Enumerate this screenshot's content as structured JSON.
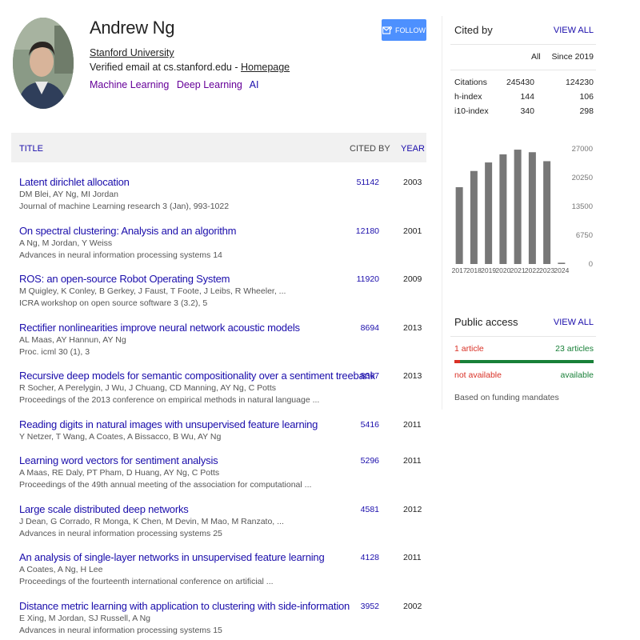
{
  "profile": {
    "name": "Andrew Ng",
    "affiliation": "Stanford University",
    "email_text": "Verified email at cs.stanford.edu - ",
    "homepage_label": "Homepage",
    "interests": [
      "Machine Learning",
      "Deep Learning",
      "AI"
    ],
    "follow_label": "FOLLOW"
  },
  "table": {
    "title_header": "TITLE",
    "cited_header": "CITED BY",
    "year_header": "YEAR",
    "articles": [
      {
        "title": "Latent dirichlet allocation",
        "authors": "DM Blei, AY Ng, MI Jordan",
        "venue": "Journal of machine Learning research 3 (Jan), 993-1022",
        "cited": "51142",
        "year": "2003"
      },
      {
        "title": "On spectral clustering: Analysis and an algorithm",
        "authors": "A Ng, M Jordan, Y Weiss",
        "venue": "Advances in neural information processing systems 14",
        "cited": "12180",
        "year": "2001"
      },
      {
        "title": "ROS: an open-source Robot Operating System",
        "authors": "M Quigley, K Conley, B Gerkey, J Faust, T Foote, J Leibs, R Wheeler, ...",
        "venue": "ICRA workshop on open source software 3 (3.2), 5",
        "cited": "11920",
        "year": "2009"
      },
      {
        "title": "Rectifier nonlinearities improve neural network acoustic models",
        "authors": "AL Maas, AY Hannun, AY Ng",
        "venue": "Proc. icml 30 (1), 3",
        "cited": "8694",
        "year": "2013"
      },
      {
        "title": "Recursive deep models for semantic compositionality over a sentiment treebank",
        "authors": "R Socher, A Perelygin, J Wu, J Chuang, CD Manning, AY Ng, C Potts",
        "venue": "Proceedings of the 2013 conference on empirical methods in natural language ...",
        "cited": "8367",
        "year": "2013"
      },
      {
        "title": "Reading digits in natural images with unsupervised feature learning",
        "authors": "Y Netzer, T Wang, A Coates, A Bissacco, B Wu, AY Ng",
        "venue": "",
        "cited": "5416",
        "year": "2011"
      },
      {
        "title": "Learning word vectors for sentiment analysis",
        "authors": "A Maas, RE Daly, PT Pham, D Huang, AY Ng, C Potts",
        "venue": "Proceedings of the 49th annual meeting of the association for computational ...",
        "cited": "5296",
        "year": "2011"
      },
      {
        "title": "Large scale distributed deep networks",
        "authors": "J Dean, G Corrado, R Monga, K Chen, M Devin, M Mao, M Ranzato, ...",
        "venue": "Advances in neural information processing systems 25",
        "cited": "4581",
        "year": "2012"
      },
      {
        "title": "An analysis of single-layer networks in unsupervised feature learning",
        "authors": "A Coates, A Ng, H Lee",
        "venue": "Proceedings of the fourteenth international conference on artificial ...",
        "cited": "4128",
        "year": "2011"
      },
      {
        "title": "Distance metric learning with application to clustering with side-information",
        "authors": "E Xing, M Jordan, SJ Russell, A Ng",
        "venue": "Advances in neural information processing systems 15",
        "cited": "3952",
        "year": "2002"
      }
    ]
  },
  "cited_by": {
    "title": "Cited by",
    "view_all": "VIEW ALL",
    "col_all": "All",
    "col_since": "Since 2019",
    "rows": [
      {
        "label": "Citations",
        "all": "245430",
        "since": "124230"
      },
      {
        "label": "h-index",
        "all": "144",
        "since": "106"
      },
      {
        "label": "i10-index",
        "all": "340",
        "since": "298"
      }
    ]
  },
  "chart_data": {
    "type": "bar",
    "categories": [
      "2017",
      "2018",
      "2019",
      "2020",
      "2021",
      "2022",
      "2023",
      "2024"
    ],
    "values": [
      18000,
      21800,
      23800,
      25700,
      26800,
      26200,
      24100,
      300
    ],
    "y_ticks": [
      "27000",
      "20250",
      "13500",
      "6750",
      "0"
    ],
    "ylim": [
      0,
      27000
    ],
    "bar_color": "#777777"
  },
  "public_access": {
    "title": "Public access",
    "view_all": "VIEW ALL",
    "left_count": "1 article",
    "right_count": "23 articles",
    "not_available_fraction": 0.042,
    "not_available": "not available",
    "available": "available",
    "note": "Based on funding mandates"
  }
}
